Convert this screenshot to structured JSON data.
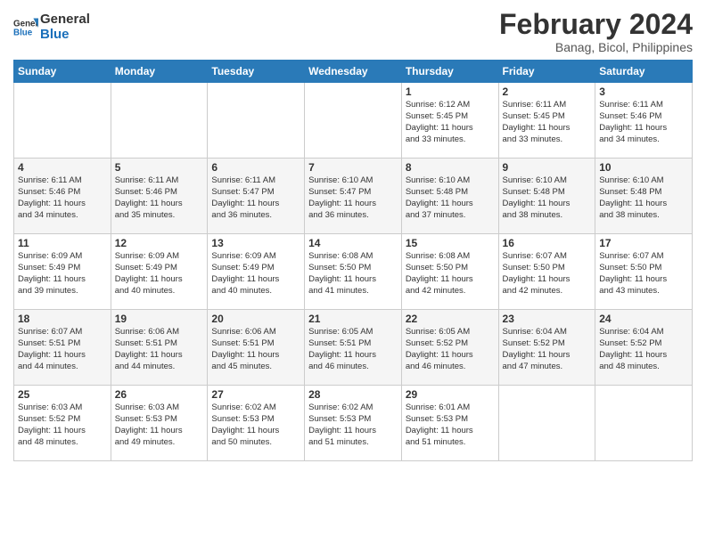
{
  "header": {
    "logo_line1": "General",
    "logo_line2": "Blue",
    "title": "February 2024",
    "subtitle": "Banag, Bicol, Philippines"
  },
  "calendar": {
    "days_of_week": [
      "Sunday",
      "Monday",
      "Tuesday",
      "Wednesday",
      "Thursday",
      "Friday",
      "Saturday"
    ],
    "weeks": [
      [
        {
          "day": "",
          "info": ""
        },
        {
          "day": "",
          "info": ""
        },
        {
          "day": "",
          "info": ""
        },
        {
          "day": "",
          "info": ""
        },
        {
          "day": "1",
          "info": "Sunrise: 6:12 AM\nSunset: 5:45 PM\nDaylight: 11 hours\nand 33 minutes."
        },
        {
          "day": "2",
          "info": "Sunrise: 6:11 AM\nSunset: 5:45 PM\nDaylight: 11 hours\nand 33 minutes."
        },
        {
          "day": "3",
          "info": "Sunrise: 6:11 AM\nSunset: 5:46 PM\nDaylight: 11 hours\nand 34 minutes."
        }
      ],
      [
        {
          "day": "4",
          "info": "Sunrise: 6:11 AM\nSunset: 5:46 PM\nDaylight: 11 hours\nand 34 minutes."
        },
        {
          "day": "5",
          "info": "Sunrise: 6:11 AM\nSunset: 5:46 PM\nDaylight: 11 hours\nand 35 minutes."
        },
        {
          "day": "6",
          "info": "Sunrise: 6:11 AM\nSunset: 5:47 PM\nDaylight: 11 hours\nand 36 minutes."
        },
        {
          "day": "7",
          "info": "Sunrise: 6:10 AM\nSunset: 5:47 PM\nDaylight: 11 hours\nand 36 minutes."
        },
        {
          "day": "8",
          "info": "Sunrise: 6:10 AM\nSunset: 5:48 PM\nDaylight: 11 hours\nand 37 minutes."
        },
        {
          "day": "9",
          "info": "Sunrise: 6:10 AM\nSunset: 5:48 PM\nDaylight: 11 hours\nand 38 minutes."
        },
        {
          "day": "10",
          "info": "Sunrise: 6:10 AM\nSunset: 5:48 PM\nDaylight: 11 hours\nand 38 minutes."
        }
      ],
      [
        {
          "day": "11",
          "info": "Sunrise: 6:09 AM\nSunset: 5:49 PM\nDaylight: 11 hours\nand 39 minutes."
        },
        {
          "day": "12",
          "info": "Sunrise: 6:09 AM\nSunset: 5:49 PM\nDaylight: 11 hours\nand 40 minutes."
        },
        {
          "day": "13",
          "info": "Sunrise: 6:09 AM\nSunset: 5:49 PM\nDaylight: 11 hours\nand 40 minutes."
        },
        {
          "day": "14",
          "info": "Sunrise: 6:08 AM\nSunset: 5:50 PM\nDaylight: 11 hours\nand 41 minutes."
        },
        {
          "day": "15",
          "info": "Sunrise: 6:08 AM\nSunset: 5:50 PM\nDaylight: 11 hours\nand 42 minutes."
        },
        {
          "day": "16",
          "info": "Sunrise: 6:07 AM\nSunset: 5:50 PM\nDaylight: 11 hours\nand 42 minutes."
        },
        {
          "day": "17",
          "info": "Sunrise: 6:07 AM\nSunset: 5:50 PM\nDaylight: 11 hours\nand 43 minutes."
        }
      ],
      [
        {
          "day": "18",
          "info": "Sunrise: 6:07 AM\nSunset: 5:51 PM\nDaylight: 11 hours\nand 44 minutes."
        },
        {
          "day": "19",
          "info": "Sunrise: 6:06 AM\nSunset: 5:51 PM\nDaylight: 11 hours\nand 44 minutes."
        },
        {
          "day": "20",
          "info": "Sunrise: 6:06 AM\nSunset: 5:51 PM\nDaylight: 11 hours\nand 45 minutes."
        },
        {
          "day": "21",
          "info": "Sunrise: 6:05 AM\nSunset: 5:51 PM\nDaylight: 11 hours\nand 46 minutes."
        },
        {
          "day": "22",
          "info": "Sunrise: 6:05 AM\nSunset: 5:52 PM\nDaylight: 11 hours\nand 46 minutes."
        },
        {
          "day": "23",
          "info": "Sunrise: 6:04 AM\nSunset: 5:52 PM\nDaylight: 11 hours\nand 47 minutes."
        },
        {
          "day": "24",
          "info": "Sunrise: 6:04 AM\nSunset: 5:52 PM\nDaylight: 11 hours\nand 48 minutes."
        }
      ],
      [
        {
          "day": "25",
          "info": "Sunrise: 6:03 AM\nSunset: 5:52 PM\nDaylight: 11 hours\nand 48 minutes."
        },
        {
          "day": "26",
          "info": "Sunrise: 6:03 AM\nSunset: 5:53 PM\nDaylight: 11 hours\nand 49 minutes."
        },
        {
          "day": "27",
          "info": "Sunrise: 6:02 AM\nSunset: 5:53 PM\nDaylight: 11 hours\nand 50 minutes."
        },
        {
          "day": "28",
          "info": "Sunrise: 6:02 AM\nSunset: 5:53 PM\nDaylight: 11 hours\nand 51 minutes."
        },
        {
          "day": "29",
          "info": "Sunrise: 6:01 AM\nSunset: 5:53 PM\nDaylight: 11 hours\nand 51 minutes."
        },
        {
          "day": "",
          "info": ""
        },
        {
          "day": "",
          "info": ""
        }
      ]
    ]
  }
}
